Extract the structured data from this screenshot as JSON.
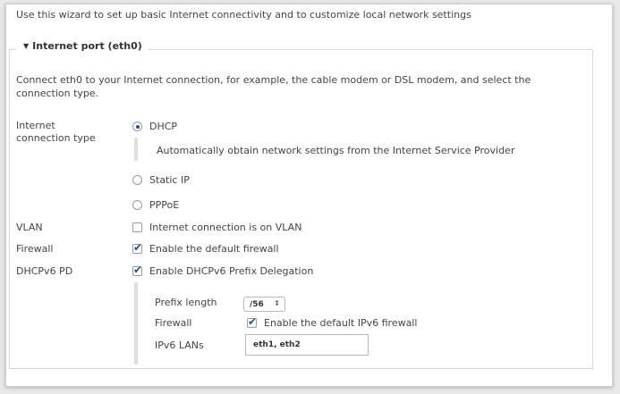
{
  "intro": "Use this wizard to set up basic Internet connectivity and to customize local network settings",
  "section": {
    "title": "Internet port (eth0)",
    "description": "Connect eth0 to your Internet connection, for example, the cable modem or DSL modem, and select the connection type."
  },
  "connection_type": {
    "label_line1": "Internet",
    "label_line2": "connection type",
    "options": [
      {
        "label": "DHCP",
        "selected": true
      },
      {
        "label": "Static IP",
        "selected": false
      },
      {
        "label": "PPPoE",
        "selected": false
      }
    ],
    "dhcp_hint": "Automatically obtain network settings from the Internet Service Provider"
  },
  "vlan": {
    "label": "VLAN",
    "option": "Internet connection is on VLAN",
    "checked": false
  },
  "firewall": {
    "label": "Firewall",
    "option": "Enable the default firewall",
    "checked": true
  },
  "dhcpv6pd": {
    "label": "DHCPv6 PD",
    "option": "Enable DHCPv6 Prefix Delegation",
    "checked": true,
    "prefix_length_label": "Prefix length",
    "prefix_length_value": "/56",
    "firewall_label": "Firewall",
    "firewall_option": "Enable the default IPv6 firewall",
    "firewall_checked": true,
    "ipv6_lans_label": "IPv6 LANs",
    "ipv6_lans_value": "eth1, eth2"
  },
  "colors": {
    "accent": "#1f4f99",
    "panel_bg": "#ffffff",
    "page_bg": "#e9e9e9"
  }
}
